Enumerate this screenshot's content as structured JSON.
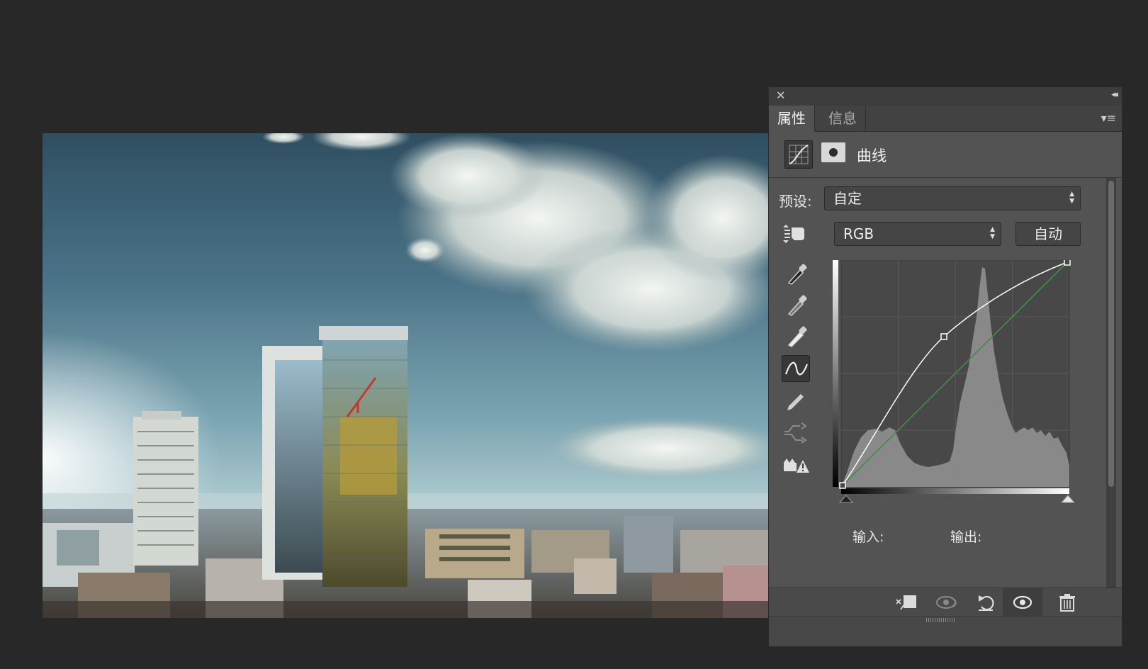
{
  "panel": {
    "close_glyph": "✕",
    "collapse_glyph": "◂◂",
    "tabs": [
      {
        "label": "属性",
        "active": true
      },
      {
        "label": "信息",
        "active": false
      }
    ],
    "menu_glyph": "▾≡",
    "adjustment_title": "曲线",
    "preset_label": "预设:",
    "preset_value": "自定",
    "channel_value": "RGB",
    "auto_label": "自动",
    "input_label": "输入:",
    "output_label": "输出:",
    "tools": [
      "on-image-adjust-icon",
      "black-point-eyedropper-icon",
      "gray-point-eyedropper-icon",
      "white-point-eyedropper-icon",
      "edit-points-curve-icon",
      "draw-pencil-icon",
      "smooth-curve-icon",
      "clipping-warning-icon"
    ],
    "bottom_icons": [
      "clip-to-layer-icon",
      "view-previous-state-icon",
      "reset-icon",
      "visibility-eye-icon",
      "trash-icon"
    ]
  },
  "curve": {
    "points": [
      [
        0,
        0
      ],
      [
        91,
        148
      ],
      [
        255,
        255
      ]
    ],
    "baseline_color": "#3f8f3f",
    "curve_color": "#ffffff"
  },
  "colors": {
    "panel_bg": "#535353",
    "app_bg": "#282828"
  }
}
